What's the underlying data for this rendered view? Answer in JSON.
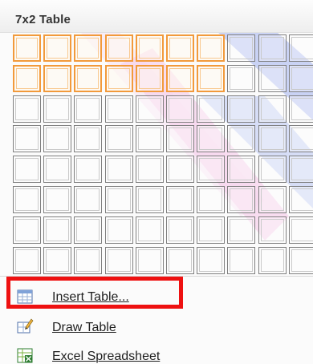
{
  "header": {
    "title": "7x2 Table"
  },
  "grid": {
    "columns": 10,
    "rows": 8,
    "selected_columns": 7,
    "selected_rows": 2
  },
  "menu": {
    "items": [
      {
        "label": "Insert Table...",
        "icon": "insert-table-icon"
      },
      {
        "label": "Draw Table",
        "icon": "draw-table-pencil-icon"
      },
      {
        "label": "Excel Spreadsheet",
        "icon": "excel-spreadsheet-icon"
      }
    ]
  },
  "colors": {
    "selection_border": "#f29a3b",
    "cell_border": "#7f7f7f",
    "annotation_highlight": "#ee1111"
  }
}
